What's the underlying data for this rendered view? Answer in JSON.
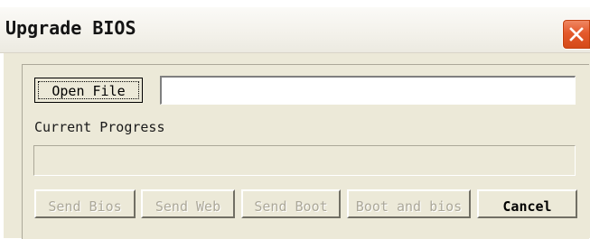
{
  "window": {
    "title": "Upgrade BIOS"
  },
  "file": {
    "open_label": "Open File",
    "path_value": ""
  },
  "progress": {
    "label": "Current Progress",
    "fraction": 0
  },
  "actions": {
    "send_bios": "Send Bios",
    "send_web": "Send Web",
    "send_boot": "Send Boot",
    "boot_and_bios": "Boot and bios",
    "cancel": "Cancel"
  },
  "colors": {
    "close_button": "#e45a2c",
    "dialog_face": "#ece9d8",
    "disabled_text": "#aca899"
  },
  "icons": {
    "close": "close-icon"
  }
}
